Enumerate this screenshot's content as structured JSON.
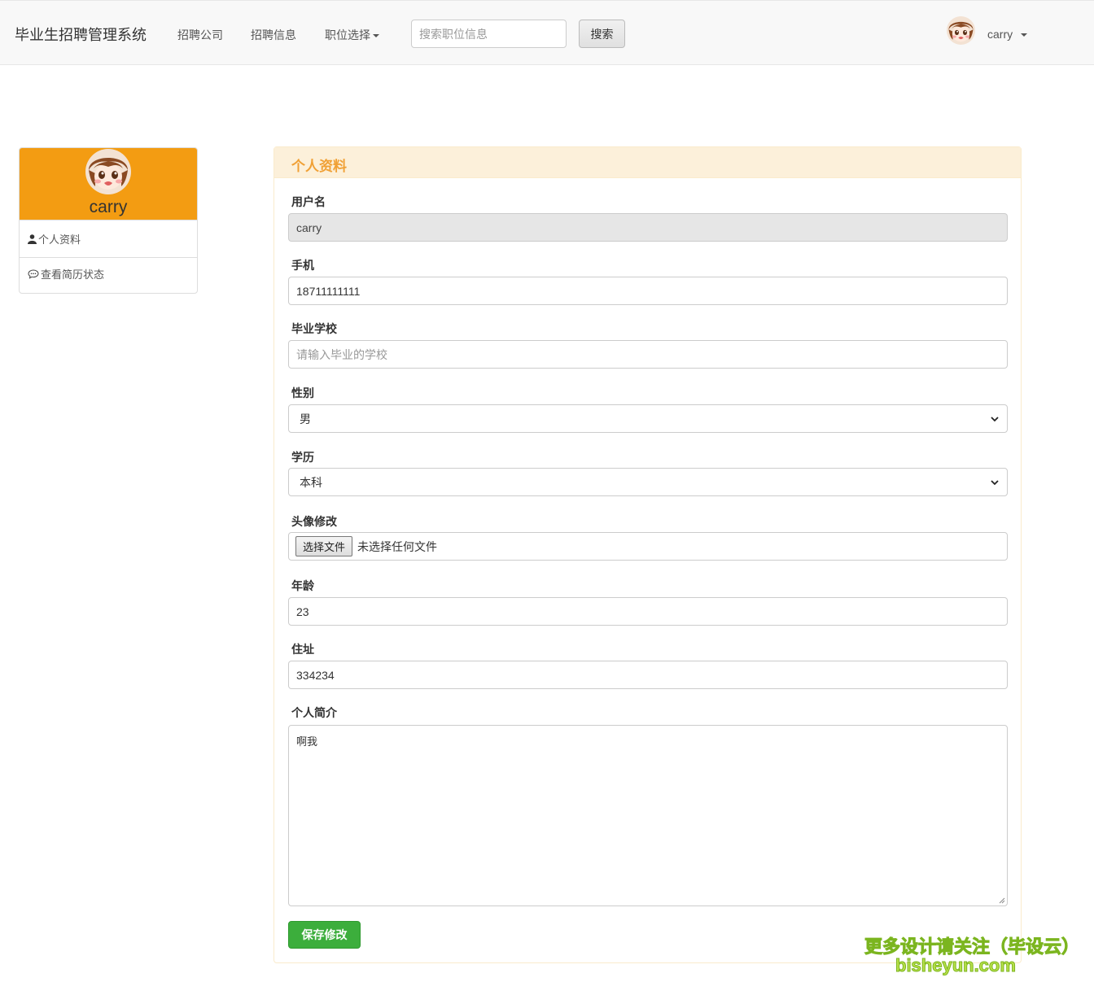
{
  "header": {
    "brand": "毕业生招聘管理系统",
    "nav": [
      {
        "label": "招聘公司"
      },
      {
        "label": "招聘信息"
      },
      {
        "label": "职位选择"
      }
    ],
    "search": {
      "placeholder": "搜索职位信息",
      "button_label": "搜索"
    },
    "user": {
      "name": "carry"
    }
  },
  "sidebar": {
    "name": "carry",
    "items": [
      {
        "label": "个人资料",
        "icon": "user-icon"
      },
      {
        "label": "查看简历状态",
        "icon": "comment-icon"
      }
    ]
  },
  "panel": {
    "title": "个人资料",
    "fields": {
      "username": {
        "label": "用户名",
        "value": "carry"
      },
      "phone": {
        "label": "手机",
        "value": "18711111111"
      },
      "school": {
        "label": "毕业学校",
        "placeholder": "请输入毕业的学校"
      },
      "gender": {
        "label": "性别",
        "value": "男"
      },
      "education": {
        "label": "学历",
        "value": "本科"
      },
      "avatar": {
        "label": "头像修改",
        "button": "选择文件",
        "status": "未选择任何文件"
      },
      "age": {
        "label": "年龄",
        "value": "23"
      },
      "address": {
        "label": "住址",
        "value": "334234"
      },
      "bio": {
        "label": "个人简介",
        "value": "啊我"
      }
    },
    "save_label": "保存修改"
  },
  "watermark": {
    "line1": "更多设计请关注（毕设云）",
    "line2": "bisheyun.com"
  },
  "colors": {
    "sidebar_header": "#f39c12",
    "panel_title": "#f0a035",
    "save_button": "#3cae3c"
  }
}
